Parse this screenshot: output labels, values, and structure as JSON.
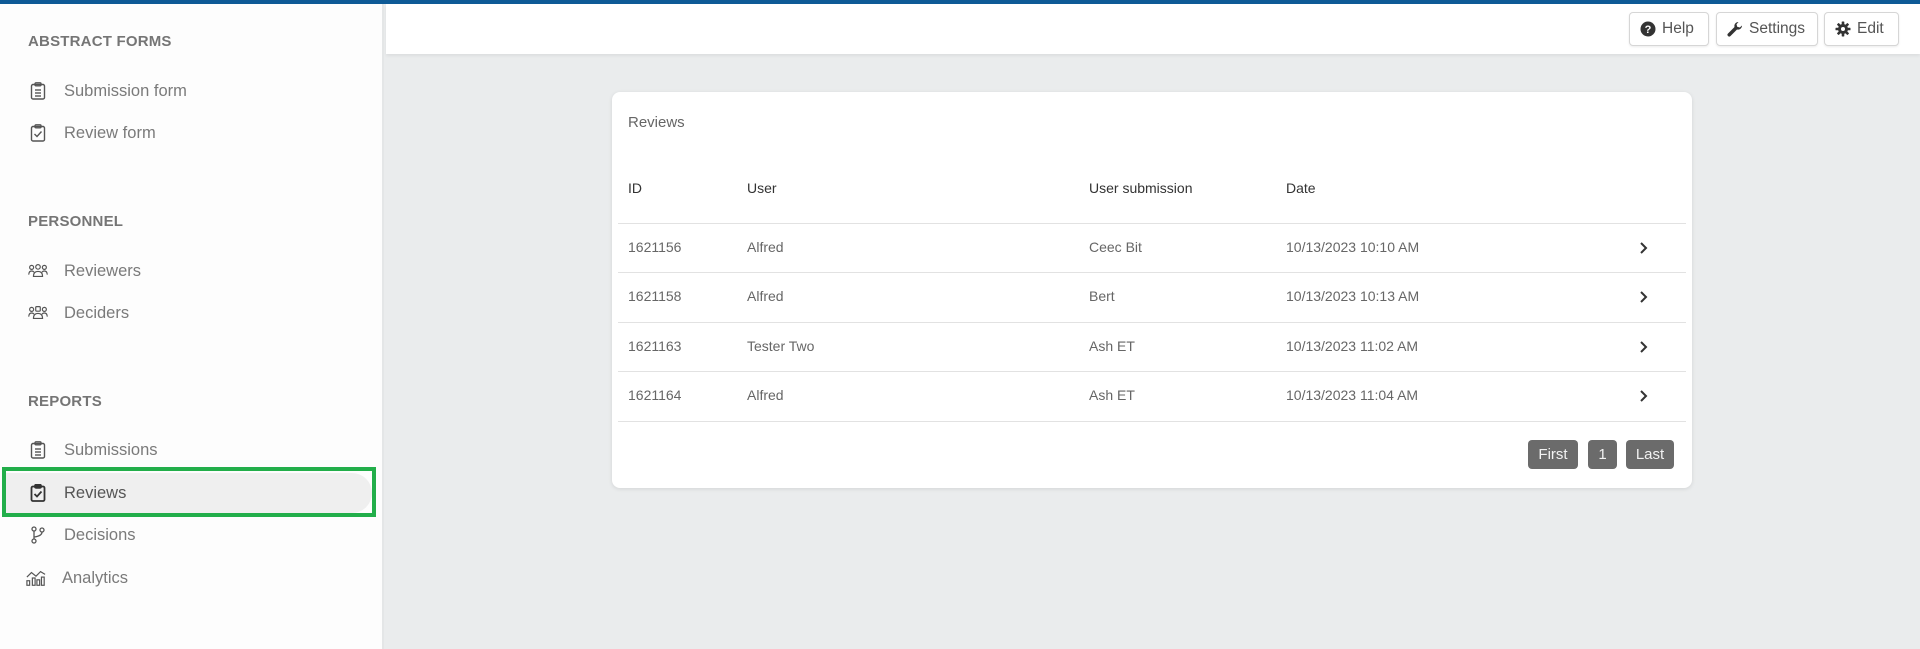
{
  "sidebar": {
    "sections": [
      {
        "title": "ABSTRACT FORMS",
        "items": [
          {
            "label": "Submission form",
            "icon": "clipboard-list-icon"
          },
          {
            "label": "Review form",
            "icon": "clipboard-check-icon"
          }
        ]
      },
      {
        "title": "PERSONNEL",
        "items": [
          {
            "label": "Reviewers",
            "icon": "users-icon"
          },
          {
            "label": "Deciders",
            "icon": "users-gavel-icon"
          }
        ]
      },
      {
        "title": "REPORTS",
        "items": [
          {
            "label": "Submissions",
            "icon": "clipboard-list-icon"
          },
          {
            "label": "Reviews",
            "icon": "clipboard-check-icon",
            "active": true
          },
          {
            "label": "Decisions",
            "icon": "branch-icon"
          },
          {
            "label": "Analytics",
            "icon": "chart-icon"
          }
        ]
      }
    ],
    "highlight_color": "#22ae4a"
  },
  "header": {
    "buttons": [
      {
        "label": "Help",
        "icon": "question-circle-icon"
      },
      {
        "label": "Settings",
        "icon": "wrench-icon"
      },
      {
        "label": "Edit",
        "icon": "gear-icon"
      }
    ],
    "accent_color": "#0e5a96"
  },
  "reviews": {
    "title": "Reviews",
    "columns": [
      "ID",
      "User",
      "User submission",
      "Date"
    ],
    "rows": [
      {
        "id": "1621156",
        "user": "Alfred",
        "submission": "Ceec Bit",
        "date": "10/13/2023 10:10 AM"
      },
      {
        "id": "1621158",
        "user": "Alfred",
        "submission": "Bert",
        "date": "10/13/2023 10:13 AM"
      },
      {
        "id": "1621163",
        "user": "Tester Two",
        "submission": "Ash ET",
        "date": "10/13/2023 11:02 AM"
      },
      {
        "id": "1621164",
        "user": "Alfred",
        "submission": "Ash ET",
        "date": "10/13/2023 11:04 AM"
      }
    ],
    "pagination": {
      "first": "First",
      "current": "1",
      "last": "Last"
    }
  }
}
